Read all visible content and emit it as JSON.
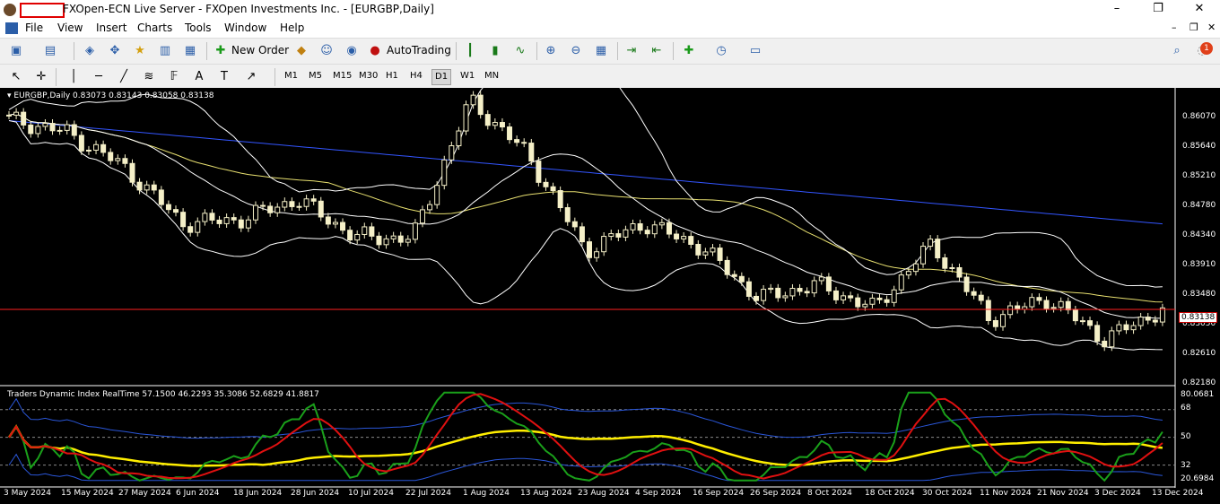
{
  "window": {
    "title": "FXOpen-ECN Live Server - FXOpen Investments Inc. - [EURGBP,Daily]",
    "minimize_glyph": "–",
    "maximize_glyph": "❐",
    "close_glyph": "✕"
  },
  "menu": [
    "File",
    "View",
    "Insert",
    "Charts",
    "Tools",
    "Window",
    "Help"
  ],
  "toolbar": {
    "new_order_label": "New Order",
    "autotrading_label": "AutoTrading",
    "notification_count": "1"
  },
  "timeframes": [
    "M1",
    "M5",
    "M15",
    "M30",
    "H1",
    "H4",
    "D1",
    "W1",
    "MN"
  ],
  "active_timeframe": "D1",
  "chart": {
    "symbol_label": "EURGBP,Daily",
    "ohlc": "0.83073 0.83143 0.83058 0.83138",
    "current_price": "0.83138",
    "price_axis": [
      "0.86070",
      "0.85640",
      "0.85210",
      "0.84780",
      "0.84340",
      "0.83910",
      "0.83480",
      "0.83050",
      "0.82610",
      "0.82180"
    ],
    "indicator_label": "Traders Dynamic Index RealTime 57.1500 46.2293 35.3086 52.6829 41.8817",
    "indicator_axis": [
      "80.0681",
      "68",
      "50",
      "32",
      "20.6984"
    ],
    "dates": [
      "3 May 2024",
      "15 May 2024",
      "27 May 2024",
      "6 Jun 2024",
      "18 Jun 2024",
      "28 Jun 2024",
      "10 Jul 2024",
      "22 Jul 2024",
      "1 Aug 2024",
      "13 Aug 2024",
      "23 Aug 2024",
      "4 Sep 2024",
      "16 Sep 2024",
      "26 Sep 2024",
      "8 Oct 2024",
      "18 Oct 2024",
      "30 Oct 2024",
      "11 Nov 2024",
      "21 Nov 2024",
      "3 Dec 2024",
      "13 Dec 2024"
    ]
  },
  "colors": {
    "bull_candle": "#f5f0c8",
    "bear_candle": "#f5f0c8",
    "bollinger": "#ffffff",
    "ma_blue": "#3355ff",
    "ma_yellow": "#e8e070",
    "price_line": "#ff2020",
    "tdi_green": "#1aa01a",
    "tdi_red": "#e01010",
    "tdi_yellow": "#ffee00",
    "tdi_blue": "#2a56d8"
  },
  "chart_data": {
    "type": "line",
    "x": [
      "3 May 2024",
      "15 May 2024",
      "27 May 2024",
      "6 Jun 2024",
      "18 Jun 2024",
      "28 Jun 2024",
      "10 Jul 2024",
      "22 Jul 2024",
      "1 Aug 2024",
      "13 Aug 2024",
      "23 Aug 2024",
      "4 Sep 2024",
      "16 Sep 2024",
      "26 Sep 2024",
      "8 Oct 2024",
      "18 Oct 2024",
      "30 Oct 2024",
      "11 Nov 2024",
      "21 Nov 2024",
      "3 Dec 2024",
      "13 Dec 2024"
    ],
    "series": [
      {
        "values": [
          0.8592,
          0.8573,
          0.8522,
          0.844,
          0.8445,
          0.8475,
          0.842,
          0.8418,
          0.862,
          0.854,
          0.84,
          0.844,
          0.8405,
          0.833,
          0.835,
          0.8315,
          0.841,
          0.83,
          0.833,
          0.827,
          0.8314
        ]
      }
    ],
    "ylim": [
      0.8205,
      0.863
    ]
  }
}
